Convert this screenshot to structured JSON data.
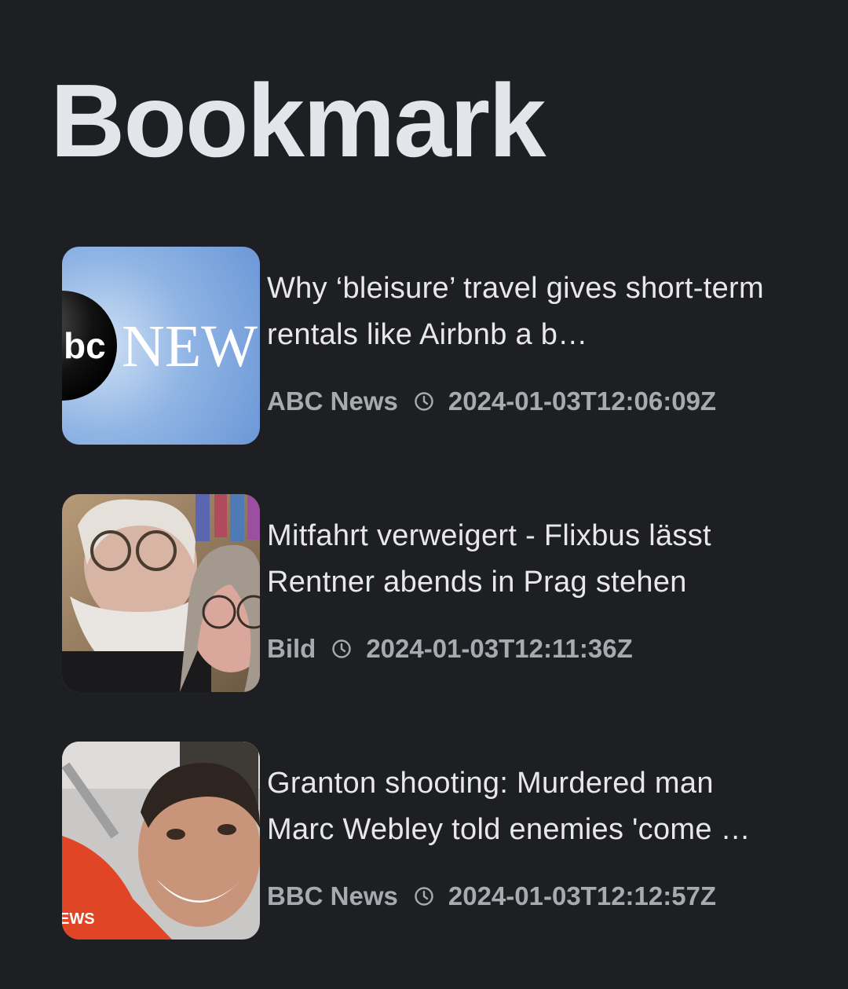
{
  "page": {
    "title": "Bookmark"
  },
  "articles": [
    {
      "headline": "Why ‘bleisure’ travel gives short-term rentals like Airbnb a b…",
      "source": "ABC News",
      "timestamp": "2024-01-03T12:06:09Z",
      "thumbnail_icon": "abc-news-logo",
      "thumbnail_text": "NEW"
    },
    {
      "headline": "Mitfahrt verweigert - Flixbus lässt Rentner abends in Prag stehen",
      "source": "Bild",
      "timestamp": "2024-01-03T12:11:36Z",
      "thumbnail_icon": "couple-selfie-photo"
    },
    {
      "headline": "Granton shooting: Murdered man Marc Webley told enemies 'come …",
      "source": "BBC News",
      "timestamp": "2024-01-03T12:12:57Z",
      "thumbnail_icon": "man-portrait-photo",
      "thumbnail_text": "EWS"
    }
  ],
  "colors": {
    "background": "#1e1f23",
    "headline": "#e8e8ec",
    "meta": "#a9aab0"
  }
}
